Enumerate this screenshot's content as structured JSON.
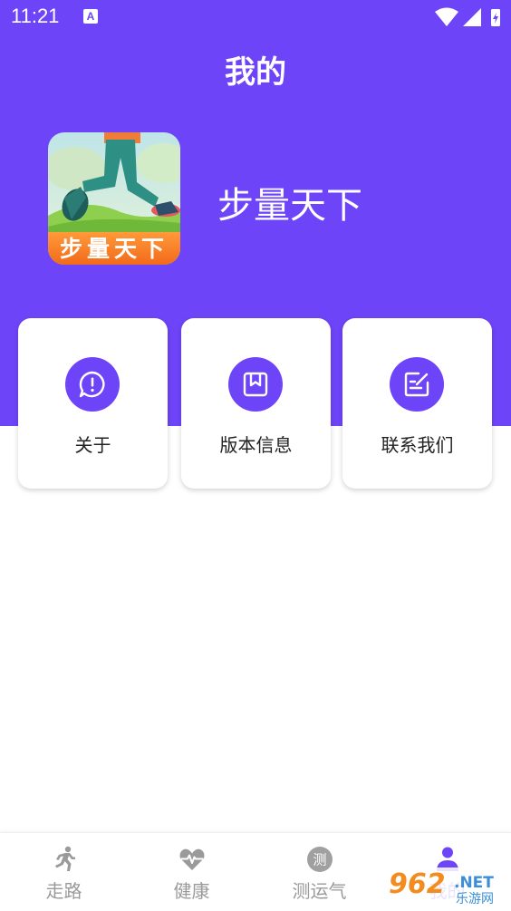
{
  "status_bar": {
    "time": "11:21",
    "notification_icon": "A"
  },
  "header": {
    "title": "我的"
  },
  "app": {
    "logo_text": "步量天下",
    "name": "步量天下"
  },
  "cards": [
    {
      "label": "关于",
      "icon": "alert-icon"
    },
    {
      "label": "版本信息",
      "icon": "bookmark-book-icon"
    },
    {
      "label": "联系我们",
      "icon": "edit-note-icon"
    }
  ],
  "bottom_nav": [
    {
      "label": "走路",
      "icon": "runner-icon"
    },
    {
      "label": "健康",
      "icon": "heartbeat-icon"
    },
    {
      "label": "测运气",
      "icon": "fortune-icon",
      "icon_text": "测"
    },
    {
      "label": "我的",
      "icon": "person-icon",
      "active": true
    }
  ],
  "watermark": {
    "number": "962",
    "net": ".NET",
    "site": "乐游网"
  },
  "colors": {
    "primary": "#6e44f8",
    "nav_inactive": "#9a9a9a"
  }
}
